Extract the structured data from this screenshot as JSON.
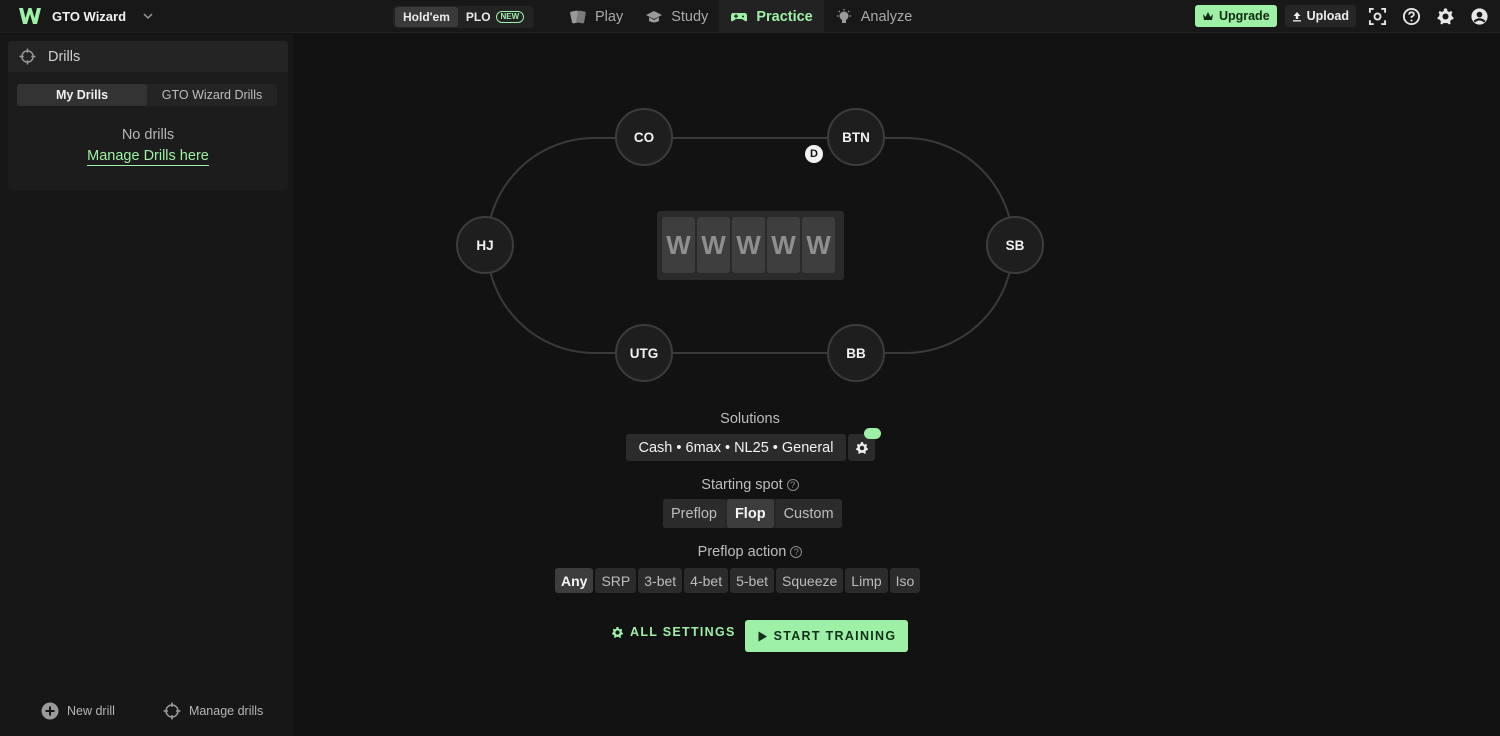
{
  "app": {
    "brand_name": "GTO Wizard",
    "game_tabs": [
      {
        "label": "Hold'em"
      },
      {
        "label": "PLO",
        "badge": "NEW"
      }
    ],
    "nav": [
      {
        "label": "Play",
        "icon": "cards-icon"
      },
      {
        "label": "Study",
        "icon": "graduation-cap-icon"
      },
      {
        "label": "Practice",
        "icon": "gamepad-icon"
      },
      {
        "label": "Analyze",
        "icon": "lightbulb-icon"
      }
    ],
    "upgrade_label": "Upgrade",
    "upload_label": "Upload",
    "accent_color": "#9ef0a6"
  },
  "sidebar": {
    "title": "Drills",
    "tabs": [
      "My Drills",
      "GTO Wizard Drills"
    ],
    "empty_text": "No drills",
    "manage_link": "Manage Drills here",
    "new_drill": "New drill",
    "manage_drills": "Manage drills"
  },
  "table": {
    "seats": [
      "CO",
      "BTN",
      "HJ",
      "SB",
      "UTG",
      "BB"
    ],
    "dealer_label": "D",
    "board_cards": [
      "W",
      "W",
      "W",
      "W",
      "W"
    ]
  },
  "controls": {
    "solutions_label": "Solutions",
    "solutions_value": "Cash • 6max • NL25 • General",
    "starting_spot_label": "Starting spot",
    "starting_spot_options": [
      "Preflop",
      "Flop",
      "Custom"
    ],
    "starting_spot_selected": "Flop",
    "preflop_action_label": "Preflop action",
    "preflop_action_options": [
      "Any",
      "SRP",
      "3-bet",
      "4-bet",
      "5-bet",
      "Squeeze",
      "Limp",
      "Iso"
    ],
    "preflop_action_selected": "Any",
    "all_settings": "ALL SETTINGS",
    "start_training": "START TRAINING"
  }
}
